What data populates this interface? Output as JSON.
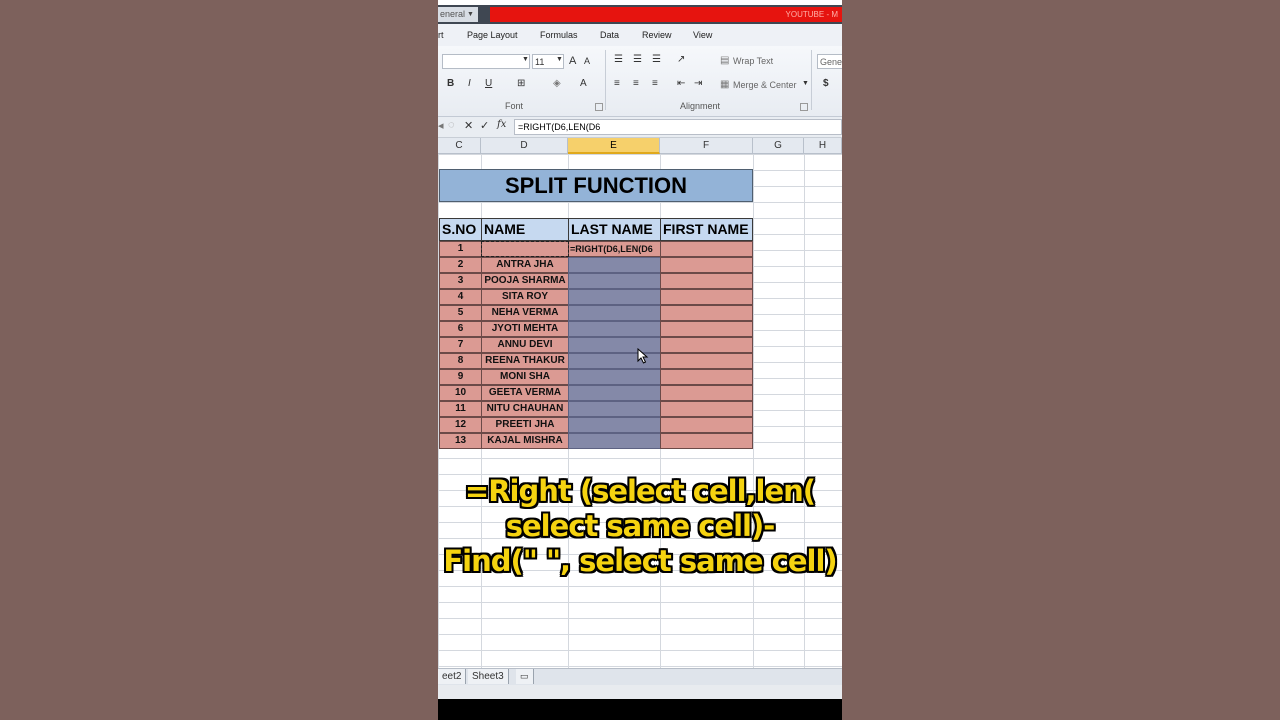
{
  "window": {
    "name_box": "eneral",
    "title": "YOUTUBE - M"
  },
  "ribbon": {
    "tabs": [
      "rt",
      "Page Layout",
      "Formulas",
      "Data",
      "Review",
      "View"
    ],
    "font_size": "11",
    "wrap_text": "Wrap Text",
    "merge_center": "Merge & Center",
    "number_format": "Gene",
    "currency": "$",
    "bold": "B",
    "italic": "I",
    "underline": "U",
    "grow_font": "A",
    "shrink_font": "A",
    "font_color": "A",
    "group_font": "Font",
    "group_alignment": "Alignment"
  },
  "formula_bar": {
    "cancel": "✕",
    "enter": "✓",
    "fx": "fx",
    "formula": "=RIGHT(D6,LEN(D6"
  },
  "columns": [
    "C",
    "D",
    "E",
    "F",
    "G",
    "H"
  ],
  "sheet": {
    "title": "SPLIT FUNCTION",
    "headers": [
      "S.NO",
      "NAME",
      "LAST NAME",
      "FIRST NAME"
    ],
    "editing_text": "=RIGHT(D6,LEN(D6",
    "rows": [
      {
        "sno": "1",
        "name": ""
      },
      {
        "sno": "2",
        "name": "ANTRA JHA"
      },
      {
        "sno": "3",
        "name": "POOJA SHARMA"
      },
      {
        "sno": "4",
        "name": "SITA ROY"
      },
      {
        "sno": "5",
        "name": "NEHA VERMA"
      },
      {
        "sno": "6",
        "name": "JYOTI MEHTA"
      },
      {
        "sno": "7",
        "name": "ANNU DEVI"
      },
      {
        "sno": "8",
        "name": "REENA THAKUR"
      },
      {
        "sno": "9",
        "name": "MONI SHA"
      },
      {
        "sno": "10",
        "name": "GEETA VERMA"
      },
      {
        "sno": "11",
        "name": "NITU CHAUHAN"
      },
      {
        "sno": "12",
        "name": "PREETI JHA"
      },
      {
        "sno": "13",
        "name": "KAJAL MISHRA"
      }
    ]
  },
  "caption": {
    "line1": "=Right (select cell,len(",
    "line2": "select same cell)-",
    "line3": "Find(\" \", select same cell)"
  },
  "sheet_tabs": [
    "eet2",
    "Sheet3"
  ],
  "colors": {
    "title_bg": "#93b3d7",
    "header_bg": "#c6d9f0",
    "row_red": "#db9a93",
    "row_selected": "#8489a8",
    "caption_yellow": "#f5d310",
    "background": "#7d615c"
  }
}
